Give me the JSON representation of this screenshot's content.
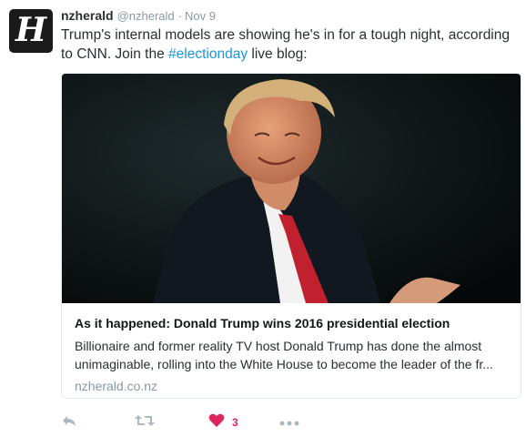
{
  "tweet": {
    "display_name": "nzherald",
    "handle": "@nzherald",
    "separator": "·",
    "date": "Nov 9",
    "text_before": "Trump's internal models are showing he's in for a tough night, according to CNN. Join the ",
    "hashtag": "#electionday",
    "text_after": " live blog:"
  },
  "card": {
    "title": "As it happened: Donald Trump wins 2016 presidential election",
    "description": "Billionaire and former reality TV host Donald Trump has done the almost unimaginable, rolling into the White House to become the leader of the fr...",
    "domain": "nzherald.co.nz"
  },
  "actions": {
    "reply_icon": "reply-icon",
    "retweet_icon": "retweet-icon",
    "like_icon": "heart-icon",
    "like_count": "3",
    "more_icon": "more-icon"
  },
  "colors": {
    "link": "#1b95e0",
    "like": "#e0245e",
    "muted": "#8899a6"
  }
}
